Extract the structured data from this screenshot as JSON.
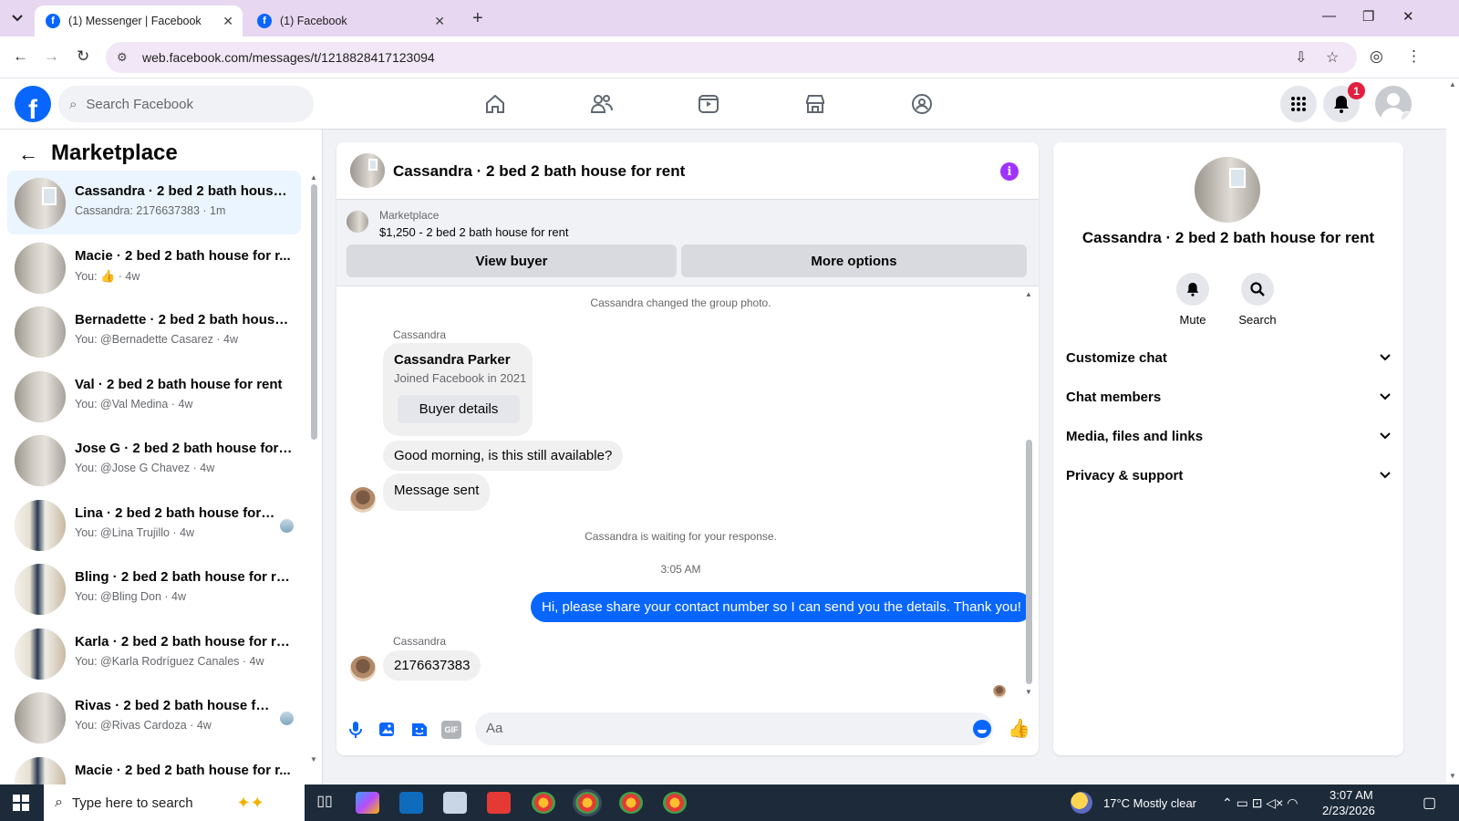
{
  "browser": {
    "tabs": [
      {
        "title": "(1) Messenger | Facebook",
        "active": true
      },
      {
        "title": "(1) Facebook",
        "active": false
      }
    ],
    "url": "web.facebook.com/messages/t/1218828417123094"
  },
  "fb": {
    "search_placeholder": "Search Facebook",
    "notifications_count": "1",
    "nav": [
      "home-icon",
      "friends-icon",
      "video-icon",
      "marketplace-icon",
      "groups-icon"
    ]
  },
  "sidebar": {
    "title": "Marketplace",
    "conversations": [
      {
        "name": "Cassandra · 2 bed 2 bath house ...",
        "sub": "Cassandra: 2176637383 · 1m",
        "selected": true,
        "img": "room"
      },
      {
        "name": "Macie · 2 bed 2 bath house for r...",
        "sub_prefix": "You:",
        "sub_suffix": "· 4w",
        "thumb": true,
        "img": "room"
      },
      {
        "name": "Bernadette · 2 bed 2 bath house...",
        "sub": "You: @Bernadette Casarez · 4w",
        "img": "room"
      },
      {
        "name": "Val · 2 bed 2 bath house for rent",
        "sub": "You: @Val Medina · 4w",
        "img": "room"
      },
      {
        "name": "Jose G · 2 bed 2 bath house for r...",
        "sub": "You: @Jose G Chavez · 4w",
        "img": "room"
      },
      {
        "name": "Lina · 2 bed 2 bath house for r...",
        "sub": "You: @Lina Trujillo · 4w",
        "img": "kitchen",
        "seen": true
      },
      {
        "name": "Bling · 2 bed 2 bath house for rent",
        "sub": "You: @Bling Don · 4w",
        "img": "kitchen"
      },
      {
        "name": "Karla · 2 bed 2 bath house for rent",
        "sub": "You: @Karla Rodríguez Canales · 4w",
        "img": "kitchen"
      },
      {
        "name": "Rivas · 2 bed 2 bath house for...",
        "sub": "You: @Rivas Cardoza · 4w",
        "img": "room",
        "seen": true
      },
      {
        "name": "Macie · 2 bed 2 bath house for r...",
        "sub": "",
        "img": "kitchen"
      }
    ]
  },
  "chat": {
    "title": "Cassandra · 2 bed 2 bath house for rent",
    "marketplace_label": "Marketplace",
    "listing": "$1,250 - 2 bed 2 bath house for rent",
    "view_buyer": "View buyer",
    "more_options": "More options",
    "sys_group_photo": "Cassandra changed the group photo.",
    "sender_name": "Cassandra",
    "card_name": "Cassandra Parker",
    "card_joined": "Joined Facebook in 2021",
    "card_button": "Buyer details",
    "msg_available": "Good morning, is this still available?",
    "msg_sent": "Message sent",
    "sys_waiting": "Cassandra is waiting for your response.",
    "timestamp": "3:05 AM",
    "msg_me": "Hi, please share your contact number so I can send you the details. Thank you!",
    "msg_number": "2176637383",
    "compose_placeholder": "Aa"
  },
  "info": {
    "name": "Cassandra · 2 bed 2 bath house for rent",
    "mute": "Mute",
    "search": "Search",
    "sections": [
      "Customize chat",
      "Chat members",
      "Media, files and links",
      "Privacy & support"
    ]
  },
  "taskbar": {
    "search_placeholder": "Type here to search",
    "weather": "17°C  Mostly clear",
    "time": "3:07 AM",
    "date": "2/23/2026"
  },
  "colors": {
    "brand": "#0866ff",
    "info_accent": "#a033ff",
    "badge": "#e41e3f"
  }
}
